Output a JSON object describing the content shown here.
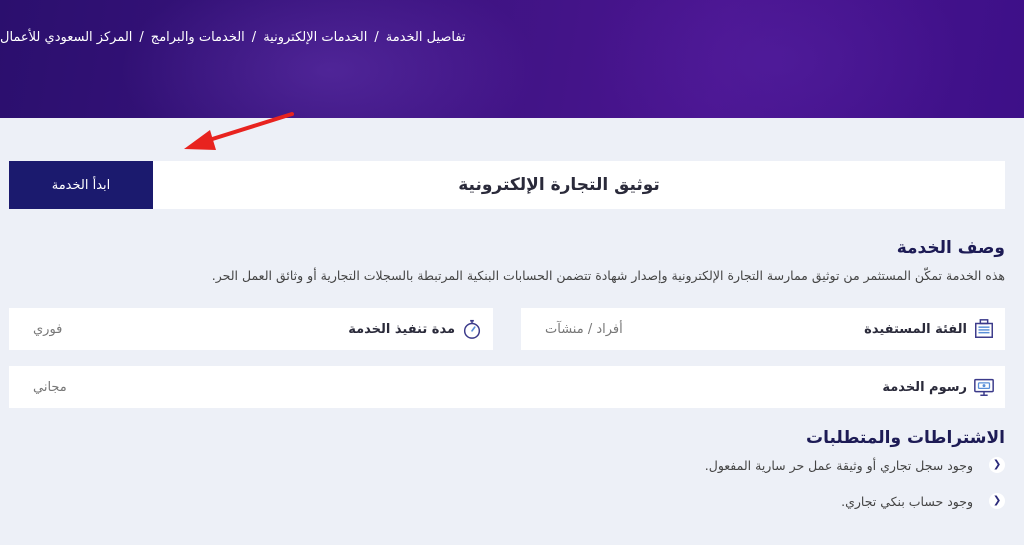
{
  "breadcrumb": {
    "items": [
      "المركز السعودي للأعمال",
      "الخدمات والبرامج",
      "الخدمات الإلكترونية",
      "تفاصيل الخدمة"
    ],
    "separator": "/"
  },
  "service": {
    "title": "توثيق التجارة الإلكترونية",
    "start_label": "ابدأ الخدمة"
  },
  "description": {
    "heading": "وصف الخدمة",
    "text": "هذه الخدمة تمكّن المستثمر من توثيق ممارسة التجارة الإلكترونية وإصدار شهادة تتضمن الحسابات البنكية المرتبطة بالسجلات التجارية أو وثائق العمل الحر."
  },
  "info": {
    "beneficiary": {
      "label": "الفئة المستفيدة",
      "value": "أفراد / منشآت",
      "icon": "building-icon"
    },
    "duration": {
      "label": "مدة تنفيذ الخدمة",
      "value": "فوري",
      "icon": "stopwatch-icon"
    },
    "fees": {
      "label": "رسوم الخدمة",
      "value": "مجاني",
      "icon": "monitor-money-icon"
    }
  },
  "requirements": {
    "heading": "الاشتراطات والمتطلبات",
    "items": [
      "وجود سجل تجاري أو وثيقة عمل حر سارية المفعول.",
      "وجود حساب بنكي تجاري."
    ]
  },
  "colors": {
    "hero": "#3a137e",
    "button": "#1b1a6e",
    "background": "#edf0f7",
    "arrow": "#e8231f"
  }
}
